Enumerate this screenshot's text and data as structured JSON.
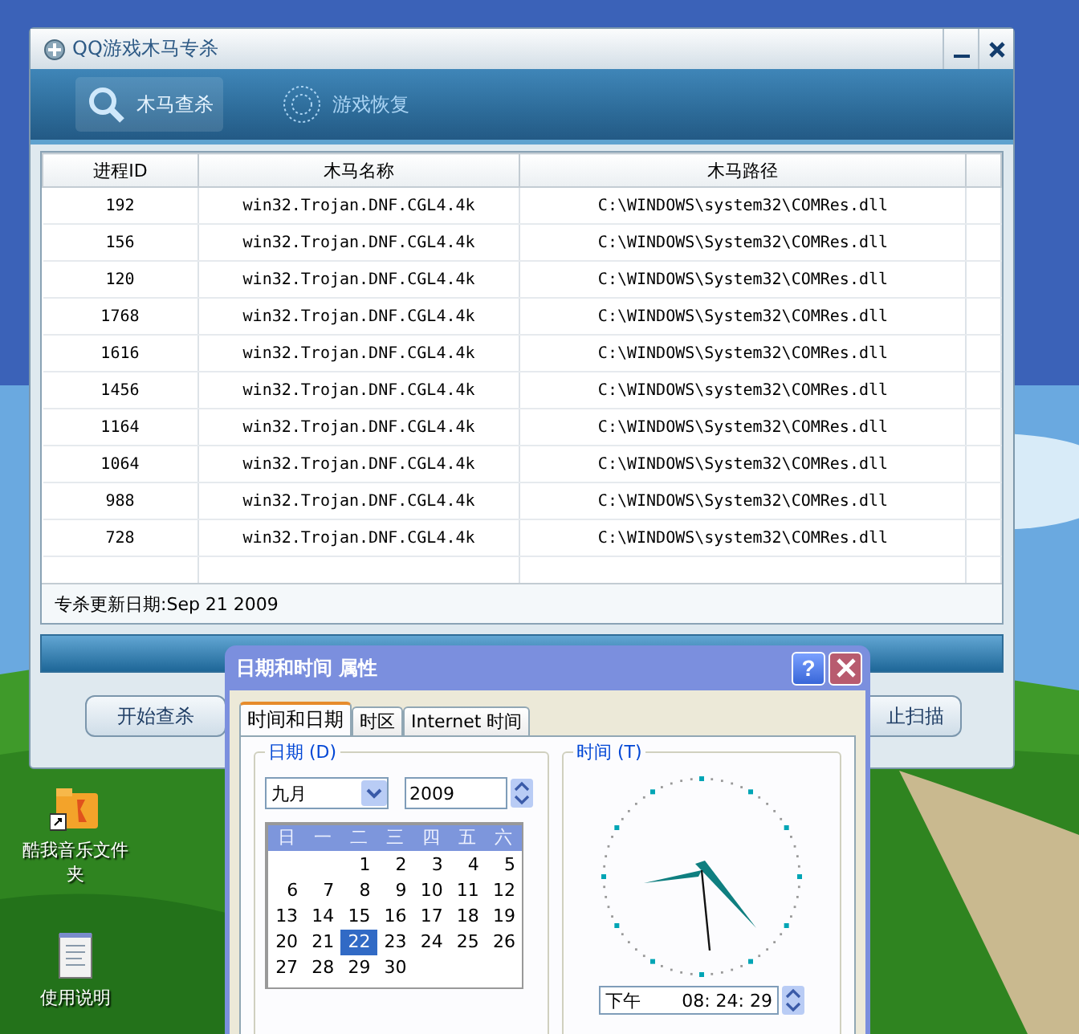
{
  "main_window": {
    "title": "QQ游戏木马专杀",
    "tabs": [
      {
        "label": "木马查杀",
        "selected": true
      },
      {
        "label": "游戏恢复",
        "selected": false
      }
    ],
    "table": {
      "columns": [
        "进程ID",
        "木马名称",
        "木马路径"
      ],
      "rows": [
        {
          "pid": "192",
          "name": "win32.Trojan.DNF.CGL4.4k",
          "path": "C:\\WINDOWS\\system32\\COMRes.dll"
        },
        {
          "pid": "156",
          "name": "win32.Trojan.DNF.CGL4.4k",
          "path": "C:\\WINDOWS\\System32\\COMRes.dll"
        },
        {
          "pid": "120",
          "name": "win32.Trojan.DNF.CGL4.4k",
          "path": "C:\\WINDOWS\\System32\\COMRes.dll"
        },
        {
          "pid": "1768",
          "name": "win32.Trojan.DNF.CGL4.4k",
          "path": "C:\\WINDOWS\\System32\\COMRes.dll"
        },
        {
          "pid": "1616",
          "name": "win32.Trojan.DNF.CGL4.4k",
          "path": "C:\\WINDOWS\\System32\\COMRes.dll"
        },
        {
          "pid": "1456",
          "name": "win32.Trojan.DNF.CGL4.4k",
          "path": "C:\\WINDOWS\\system32\\COMRes.dll"
        },
        {
          "pid": "1164",
          "name": "win32.Trojan.DNF.CGL4.4k",
          "path": "C:\\WINDOWS\\System32\\COMRes.dll"
        },
        {
          "pid": "1064",
          "name": "win32.Trojan.DNF.CGL4.4k",
          "path": "C:\\WINDOWS\\System32\\COMRes.dll"
        },
        {
          "pid": "988",
          "name": "win32.Trojan.DNF.CGL4.4k",
          "path": "C:\\WINDOWS\\System32\\COMRes.dll"
        },
        {
          "pid": "728",
          "name": "win32.Trojan.DNF.CGL4.4k",
          "path": "C:\\WINDOWS\\system32\\COMRes.dll"
        }
      ]
    },
    "update_date": "专杀更新日期:Sep 21 2009",
    "buttons": [
      "开始查杀",
      "止扫描"
    ]
  },
  "desktop_icons": [
    {
      "label": "酷我音乐文件夹",
      "kind": "folder"
    },
    {
      "label": "使用说明",
      "kind": "document"
    }
  ],
  "dialog": {
    "title": "日期和时间 属性",
    "help_button": "?",
    "tabs": [
      {
        "label": "时间和日期",
        "selected": true
      },
      {
        "label": "时区",
        "selected": false
      },
      {
        "label": "Internet 时间",
        "selected": false
      }
    ],
    "date_group": "日期 (D)",
    "month": "九月",
    "year": "2009",
    "weekdays": [
      "日",
      "一",
      "二",
      "三",
      "四",
      "五",
      "六"
    ],
    "weeks": [
      [
        {
          "day": "1",
          "selected": false
        },
        {
          "day": "2",
          "selected": false
        },
        {
          "day": "3",
          "selected": false
        },
        {
          "day": "4",
          "selected": false
        },
        {
          "day": "5",
          "selected": false
        }
      ],
      [
        {
          "day": "6",
          "selected": false
        },
        {
          "day": "7",
          "selected": false
        },
        {
          "day": "8",
          "selected": false
        },
        {
          "day": "9",
          "selected": false
        },
        {
          "day": "10",
          "selected": false
        },
        {
          "day": "11",
          "selected": false
        },
        {
          "day": "12",
          "selected": false
        }
      ],
      [
        {
          "day": "13",
          "selected": false
        },
        {
          "day": "14",
          "selected": false
        },
        {
          "day": "15",
          "selected": false
        },
        {
          "day": "16",
          "selected": false
        },
        {
          "day": "17",
          "selected": false
        },
        {
          "day": "18",
          "selected": false
        },
        {
          "day": "19",
          "selected": false
        }
      ],
      [
        {
          "day": "20",
          "selected": false
        },
        {
          "day": "21",
          "selected": false
        },
        {
          "day": "22",
          "selected": true
        },
        {
          "day": "23",
          "selected": false
        },
        {
          "day": "24",
          "selected": false
        },
        {
          "day": "25",
          "selected": false
        },
        {
          "day": "26",
          "selected": false
        }
      ],
      [
        {
          "day": "27",
          "selected": false
        },
        {
          "day": "28",
          "selected": false
        },
        {
          "day": "29",
          "selected": false
        },
        {
          "day": "30",
          "selected": false
        }
      ]
    ],
    "time_group": "时间 (T)",
    "ampm": "下午",
    "time": "08: 24: 29"
  }
}
